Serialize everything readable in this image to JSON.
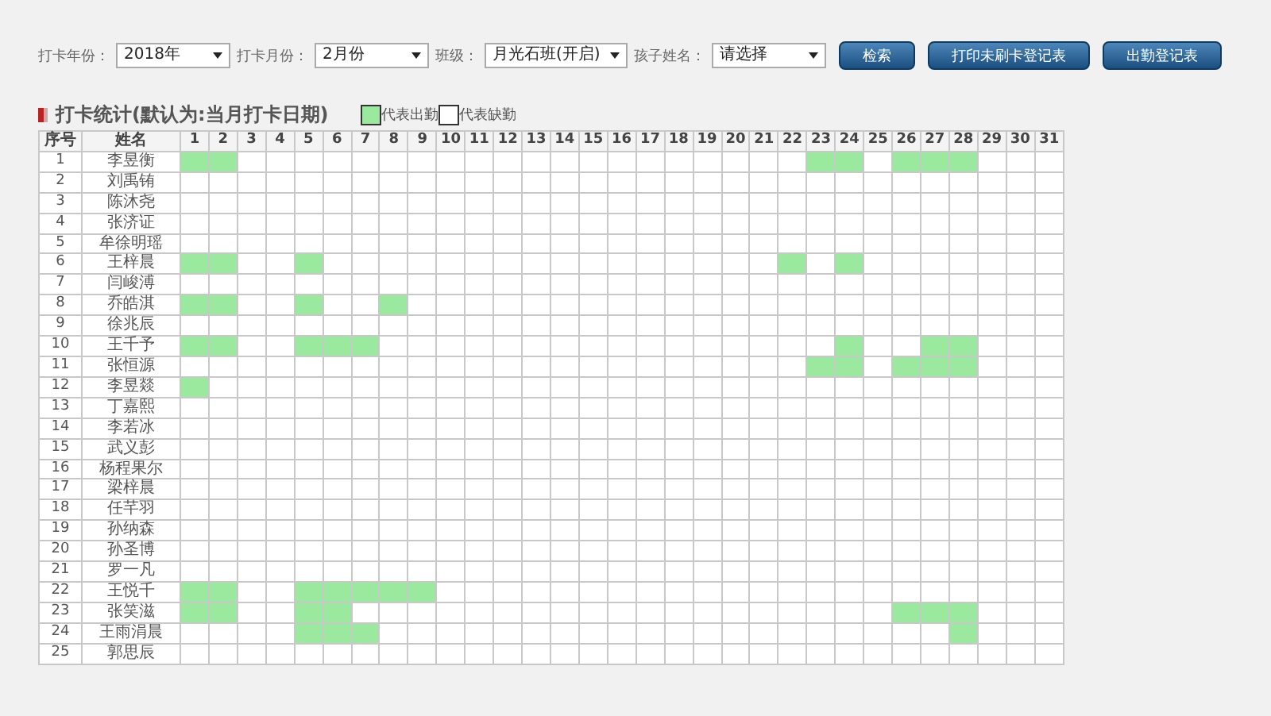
{
  "filters": [
    {
      "label": "打卡年份：",
      "value": "2018年"
    },
    {
      "label": "打卡月份：",
      "value": "2月份"
    },
    {
      "label": "班级：",
      "value": "月光石班(开启)"
    },
    {
      "label": "孩子姓名：",
      "value": "请选择"
    }
  ],
  "buttons": [
    {
      "label": "检索"
    },
    {
      "label": "打印未刷卡登记表"
    },
    {
      "label": "出勤登记表"
    }
  ],
  "section": {
    "title": "打卡统计(默认为:当月打卡日期)",
    "legend": [
      {
        "label": "代表出勤",
        "present": true
      },
      {
        "label": "代表缺勤",
        "present": false
      }
    ]
  },
  "table": {
    "columns": [
      "序号",
      "姓名",
      "1",
      "2",
      "3",
      "4",
      "5",
      "6",
      "7",
      "8",
      "9",
      "10",
      "11",
      "12",
      "13",
      "14",
      "15",
      "16",
      "17",
      "18",
      "19",
      "20",
      "21",
      "22",
      "23",
      "24",
      "25",
      "26",
      "27",
      "28",
      "29",
      "30",
      "31"
    ],
    "rows": [
      {
        "no": "1",
        "name": "李昱衡",
        "attendance": [
          true,
          true,
          false,
          false,
          false,
          false,
          false,
          false,
          false,
          false,
          false,
          false,
          false,
          false,
          false,
          false,
          false,
          false,
          false,
          false,
          false,
          false,
          true,
          true,
          false,
          true,
          true,
          true,
          false,
          false,
          false
        ]
      },
      {
        "no": "2",
        "name": "刘禹铕",
        "attendance": [
          false,
          false,
          false,
          false,
          false,
          false,
          false,
          false,
          false,
          false,
          false,
          false,
          false,
          false,
          false,
          false,
          false,
          false,
          false,
          false,
          false,
          false,
          false,
          false,
          false,
          false,
          false,
          false,
          false,
          false,
          false
        ]
      },
      {
        "no": "3",
        "name": "陈沐尧",
        "attendance": [
          false,
          false,
          false,
          false,
          false,
          false,
          false,
          false,
          false,
          false,
          false,
          false,
          false,
          false,
          false,
          false,
          false,
          false,
          false,
          false,
          false,
          false,
          false,
          false,
          false,
          false,
          false,
          false,
          false,
          false,
          false
        ]
      },
      {
        "no": "4",
        "name": "张济证",
        "attendance": [
          false,
          false,
          false,
          false,
          false,
          false,
          false,
          false,
          false,
          false,
          false,
          false,
          false,
          false,
          false,
          false,
          false,
          false,
          false,
          false,
          false,
          false,
          false,
          false,
          false,
          false,
          false,
          false,
          false,
          false,
          false
        ]
      },
      {
        "no": "5",
        "name": "牟徐明瑶",
        "attendance": [
          false,
          false,
          false,
          false,
          false,
          false,
          false,
          false,
          false,
          false,
          false,
          false,
          false,
          false,
          false,
          false,
          false,
          false,
          false,
          false,
          false,
          false,
          false,
          false,
          false,
          false,
          false,
          false,
          false,
          false,
          false
        ]
      },
      {
        "no": "6",
        "name": "王梓晨",
        "attendance": [
          true,
          true,
          false,
          false,
          true,
          false,
          false,
          false,
          false,
          false,
          false,
          false,
          false,
          false,
          false,
          false,
          false,
          false,
          false,
          false,
          false,
          true,
          false,
          true,
          false,
          false,
          false,
          false,
          false,
          false,
          false
        ]
      },
      {
        "no": "7",
        "name": "闫峻溥",
        "attendance": [
          false,
          false,
          false,
          false,
          false,
          false,
          false,
          false,
          false,
          false,
          false,
          false,
          false,
          false,
          false,
          false,
          false,
          false,
          false,
          false,
          false,
          false,
          false,
          false,
          false,
          false,
          false,
          false,
          false,
          false,
          false
        ]
      },
      {
        "no": "8",
        "name": "乔皓淇",
        "attendance": [
          true,
          true,
          false,
          false,
          true,
          false,
          false,
          true,
          false,
          false,
          false,
          false,
          false,
          false,
          false,
          false,
          false,
          false,
          false,
          false,
          false,
          false,
          false,
          false,
          false,
          false,
          false,
          false,
          false,
          false,
          false
        ]
      },
      {
        "no": "9",
        "name": "徐兆辰",
        "attendance": [
          false,
          false,
          false,
          false,
          false,
          false,
          false,
          false,
          false,
          false,
          false,
          false,
          false,
          false,
          false,
          false,
          false,
          false,
          false,
          false,
          false,
          false,
          false,
          false,
          false,
          false,
          false,
          false,
          false,
          false,
          false
        ]
      },
      {
        "no": "10",
        "name": "王千予",
        "attendance": [
          true,
          true,
          false,
          false,
          true,
          true,
          true,
          false,
          false,
          false,
          false,
          false,
          false,
          false,
          false,
          false,
          false,
          false,
          false,
          false,
          false,
          false,
          false,
          true,
          false,
          false,
          true,
          true,
          false,
          false,
          false
        ]
      },
      {
        "no": "11",
        "name": "张恒源",
        "attendance": [
          false,
          false,
          false,
          false,
          false,
          false,
          false,
          false,
          false,
          false,
          false,
          false,
          false,
          false,
          false,
          false,
          false,
          false,
          false,
          false,
          false,
          false,
          true,
          true,
          false,
          true,
          true,
          true,
          false,
          false,
          false
        ]
      },
      {
        "no": "12",
        "name": "李昱燚",
        "attendance": [
          true,
          false,
          false,
          false,
          false,
          false,
          false,
          false,
          false,
          false,
          false,
          false,
          false,
          false,
          false,
          false,
          false,
          false,
          false,
          false,
          false,
          false,
          false,
          false,
          false,
          false,
          false,
          false,
          false,
          false,
          false
        ]
      },
      {
        "no": "13",
        "name": "丁嘉熙",
        "attendance": [
          false,
          false,
          false,
          false,
          false,
          false,
          false,
          false,
          false,
          false,
          false,
          false,
          false,
          false,
          false,
          false,
          false,
          false,
          false,
          false,
          false,
          false,
          false,
          false,
          false,
          false,
          false,
          false,
          false,
          false,
          false
        ]
      },
      {
        "no": "14",
        "name": "李若冰",
        "attendance": [
          false,
          false,
          false,
          false,
          false,
          false,
          false,
          false,
          false,
          false,
          false,
          false,
          false,
          false,
          false,
          false,
          false,
          false,
          false,
          false,
          false,
          false,
          false,
          false,
          false,
          false,
          false,
          false,
          false,
          false,
          false
        ]
      },
      {
        "no": "15",
        "name": "武义彭",
        "attendance": [
          false,
          false,
          false,
          false,
          false,
          false,
          false,
          false,
          false,
          false,
          false,
          false,
          false,
          false,
          false,
          false,
          false,
          false,
          false,
          false,
          false,
          false,
          false,
          false,
          false,
          false,
          false,
          false,
          false,
          false,
          false
        ]
      },
      {
        "no": "16",
        "name": "杨程果尔",
        "attendance": [
          false,
          false,
          false,
          false,
          false,
          false,
          false,
          false,
          false,
          false,
          false,
          false,
          false,
          false,
          false,
          false,
          false,
          false,
          false,
          false,
          false,
          false,
          false,
          false,
          false,
          false,
          false,
          false,
          false,
          false,
          false
        ]
      },
      {
        "no": "17",
        "name": "梁梓晨",
        "attendance": [
          false,
          false,
          false,
          false,
          false,
          false,
          false,
          false,
          false,
          false,
          false,
          false,
          false,
          false,
          false,
          false,
          false,
          false,
          false,
          false,
          false,
          false,
          false,
          false,
          false,
          false,
          false,
          false,
          false,
          false,
          false
        ]
      },
      {
        "no": "18",
        "name": "任芊羽",
        "attendance": [
          false,
          false,
          false,
          false,
          false,
          false,
          false,
          false,
          false,
          false,
          false,
          false,
          false,
          false,
          false,
          false,
          false,
          false,
          false,
          false,
          false,
          false,
          false,
          false,
          false,
          false,
          false,
          false,
          false,
          false,
          false
        ]
      },
      {
        "no": "19",
        "name": "孙纳森",
        "attendance": [
          false,
          false,
          false,
          false,
          false,
          false,
          false,
          false,
          false,
          false,
          false,
          false,
          false,
          false,
          false,
          false,
          false,
          false,
          false,
          false,
          false,
          false,
          false,
          false,
          false,
          false,
          false,
          false,
          false,
          false,
          false
        ]
      },
      {
        "no": "20",
        "name": "孙圣博",
        "attendance": [
          false,
          false,
          false,
          false,
          false,
          false,
          false,
          false,
          false,
          false,
          false,
          false,
          false,
          false,
          false,
          false,
          false,
          false,
          false,
          false,
          false,
          false,
          false,
          false,
          false,
          false,
          false,
          false,
          false,
          false,
          false
        ]
      },
      {
        "no": "21",
        "name": "罗一凡",
        "attendance": [
          false,
          false,
          false,
          false,
          false,
          false,
          false,
          false,
          false,
          false,
          false,
          false,
          false,
          false,
          false,
          false,
          false,
          false,
          false,
          false,
          false,
          false,
          false,
          false,
          false,
          false,
          false,
          false,
          false,
          false,
          false
        ]
      },
      {
        "no": "22",
        "name": "王悦千",
        "attendance": [
          true,
          true,
          false,
          false,
          true,
          true,
          true,
          true,
          true,
          false,
          false,
          false,
          false,
          false,
          false,
          false,
          false,
          false,
          false,
          false,
          false,
          false,
          false,
          false,
          false,
          false,
          false,
          false,
          false,
          false,
          false
        ]
      },
      {
        "no": "23",
        "name": "张笑滋",
        "attendance": [
          true,
          true,
          false,
          false,
          true,
          true,
          false,
          false,
          false,
          false,
          false,
          false,
          false,
          false,
          false,
          false,
          false,
          false,
          false,
          false,
          false,
          false,
          false,
          false,
          false,
          true,
          true,
          true,
          false,
          false,
          false
        ]
      },
      {
        "no": "24",
        "name": "王雨涓晨",
        "attendance": [
          false,
          false,
          false,
          false,
          true,
          true,
          true,
          false,
          false,
          false,
          false,
          false,
          false,
          false,
          false,
          false,
          false,
          false,
          false,
          false,
          false,
          false,
          false,
          false,
          false,
          false,
          false,
          true,
          false,
          false,
          false
        ]
      },
      {
        "no": "25",
        "name": "郭思辰",
        "attendance": [
          false,
          false,
          false,
          false,
          false,
          false,
          false,
          false,
          false,
          false,
          false,
          false,
          false,
          false,
          false,
          false,
          false,
          false,
          false,
          false,
          false,
          false,
          false,
          false,
          false,
          false,
          false,
          false,
          false,
          false,
          false
        ]
      }
    ]
  }
}
